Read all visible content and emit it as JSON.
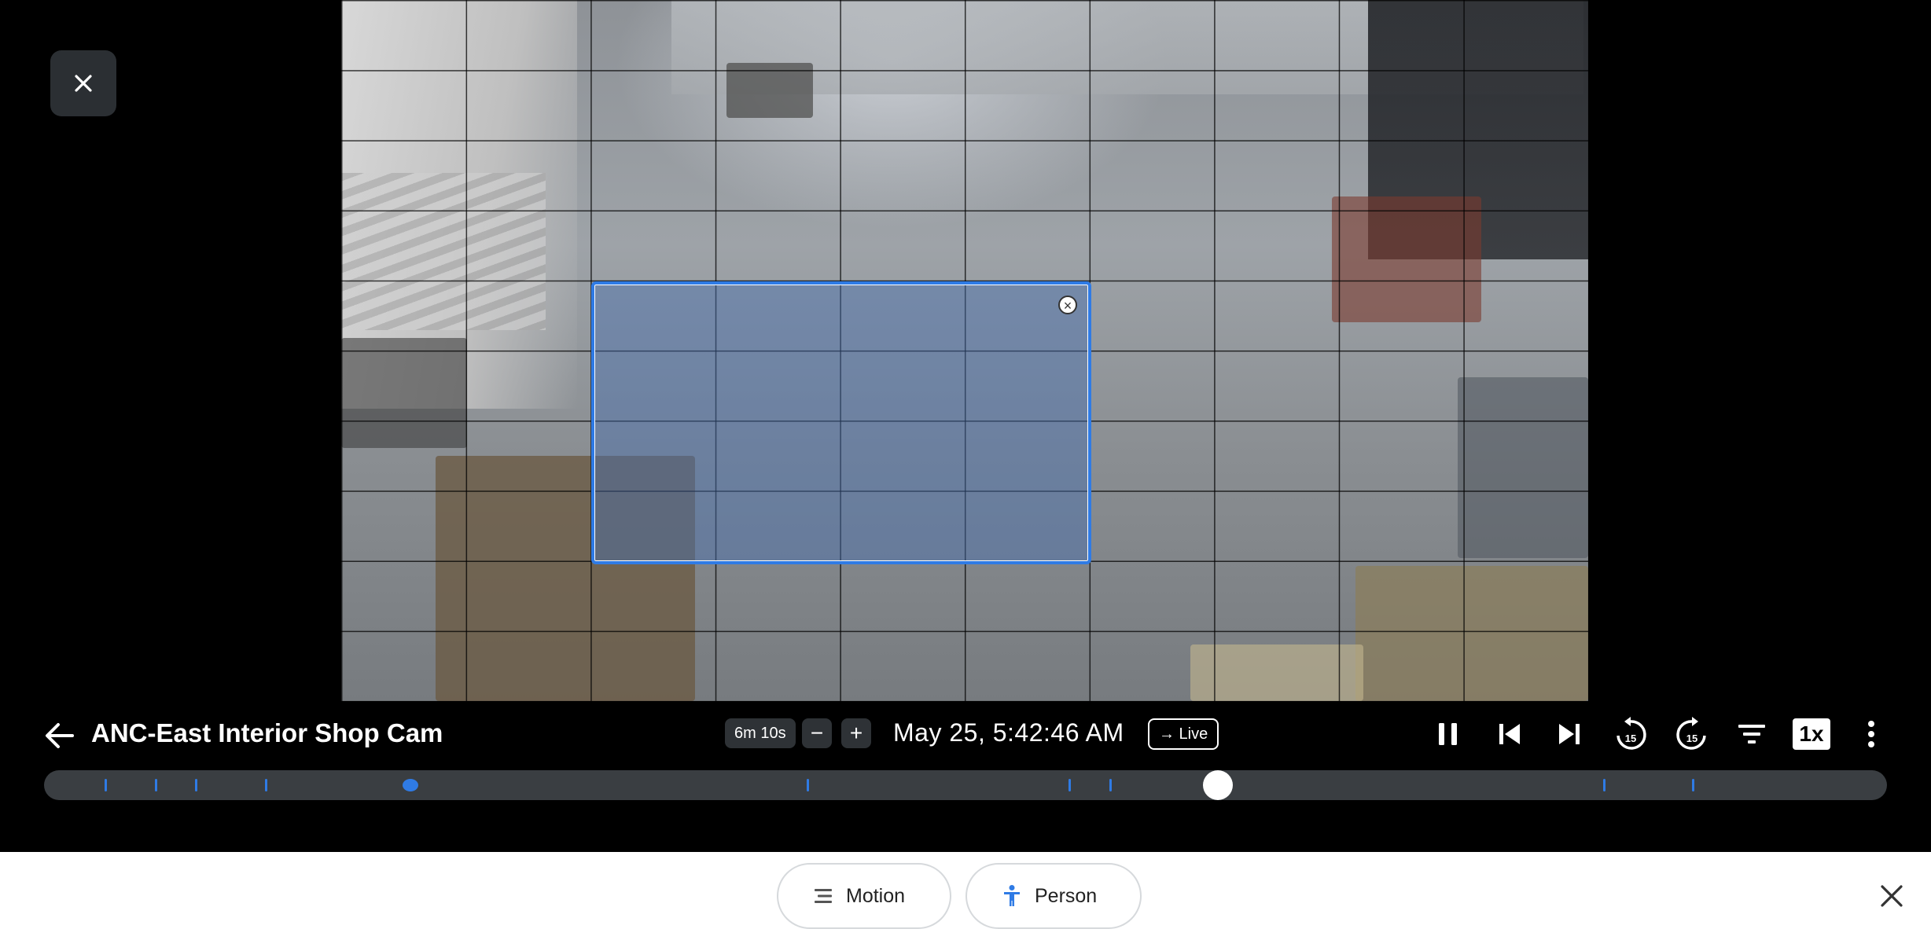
{
  "camera": {
    "title": "ANC-East Interior Shop Cam",
    "duration_label": "6m 10s",
    "timestamp": "May 25, 5:42:46 AM",
    "live_label": "→ Live",
    "speed_label": "1x"
  },
  "zoom": {
    "minus_label": "−",
    "plus_label": "+"
  },
  "timeline": {
    "playhead_fraction": 0.637,
    "event_ticks": [
      0.033,
      0.06,
      0.082,
      0.12,
      0.414,
      0.556,
      0.578,
      0.846,
      0.894
    ],
    "highlighted_event": 0.199
  },
  "filters": [
    {
      "label": "Motion",
      "icon": "motion-lines-icon"
    },
    {
      "label": "Person",
      "icon": "person-icon"
    }
  ],
  "colors": {
    "accent": "#2f7be5",
    "bar_bg": "#000000",
    "timeline_track": "#3a3e42",
    "sheet_bg": "#ffffff"
  }
}
